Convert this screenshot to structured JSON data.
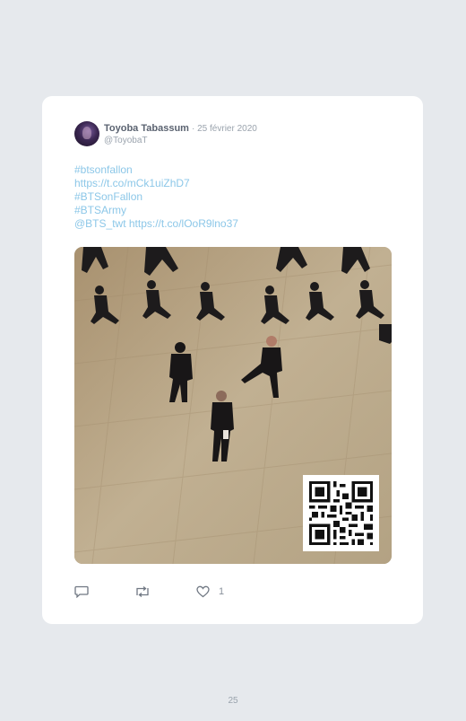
{
  "tweet": {
    "author_name": "Toyoba Tabassum",
    "date": "· 25 février 2020",
    "handle": "@ToyobaT",
    "text_lines": [
      "#btsonfallon",
      "https://t.co/mCk1uiZhD7",
      "#BTSonFallon",
      "#BTSArmy",
      "@BTS_twt https://t.co/lOoR9lno37"
    ],
    "media": {
      "description_icon": "dance-video-thumbnail",
      "qr_code_icon": "qr-code-icon"
    },
    "actions": {
      "reply_icon": "reply-icon",
      "retweet_icon": "retweet-icon",
      "like_icon": "heart-icon",
      "like_count": "1"
    }
  },
  "page": {
    "number": "25"
  },
  "colors": {
    "background": "#e6e9ed",
    "card": "#ffffff",
    "link": "#8cc7e8",
    "muted": "#9aa3ad",
    "name": "#5a6270"
  }
}
